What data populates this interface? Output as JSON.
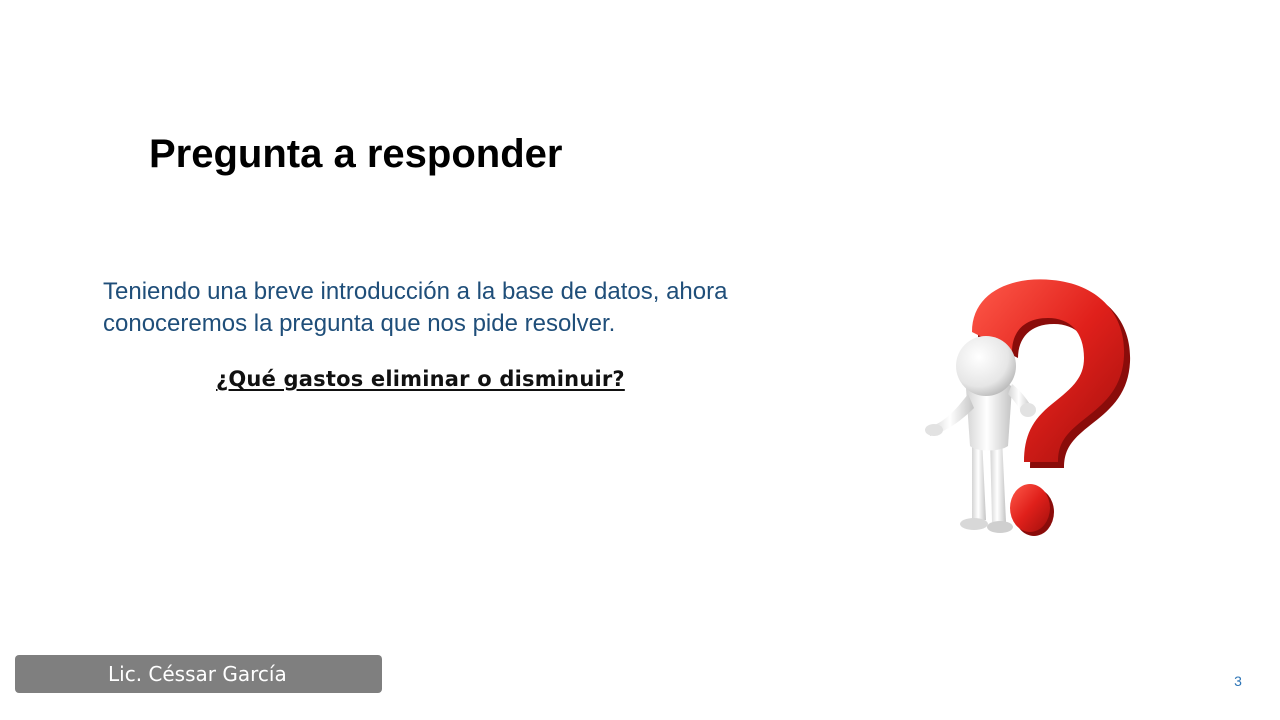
{
  "slide": {
    "title": "Pregunta a responder",
    "intro_lines": [
      "Teniendo una breve introducción a la base de datos, ahora",
      "conoceremos la pregunta que nos pide resolver."
    ],
    "question": "¿Qué gastos eliminar o disminuir?",
    "illustration_icon": "question-mark-person-icon",
    "footer_author": "Lic. Céssar García",
    "page_number": "3",
    "colors": {
      "title": "#000000",
      "intro_text": "#1f4e79",
      "question_mark": "#e0201b",
      "footer_bg": "#7f7f7f",
      "page_number": "#2e75b6"
    }
  }
}
